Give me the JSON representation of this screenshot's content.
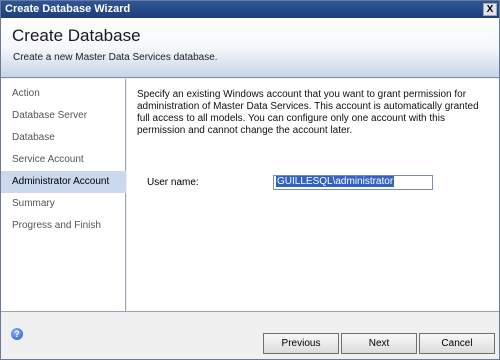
{
  "window": {
    "title": "Create Database Wizard",
    "close_glyph": "X"
  },
  "banner": {
    "title": "Create Database",
    "subtitle": "Create a new Master Data Services database."
  },
  "sidebar": {
    "items": [
      {
        "label": "Action",
        "active": false
      },
      {
        "label": "Database Server",
        "active": false
      },
      {
        "label": "Database",
        "active": false
      },
      {
        "label": "Service Account",
        "active": false
      },
      {
        "label": "Administrator Account",
        "active": true
      },
      {
        "label": "Summary",
        "active": false
      },
      {
        "label": "Progress and Finish",
        "active": false
      }
    ]
  },
  "content": {
    "description": "Specify an existing Windows account that you want to grant permission for administration of Master Data Services. This account is automatically granted full access to all models. You can configure only one account with this permission and cannot change the account later.",
    "username_label": "User name:",
    "username_value": "GUILLESQL\\administrator"
  },
  "footer": {
    "help_icon": "help-icon",
    "previous_label": "Previous",
    "next_label": "Next",
    "cancel_label": "Cancel"
  }
}
